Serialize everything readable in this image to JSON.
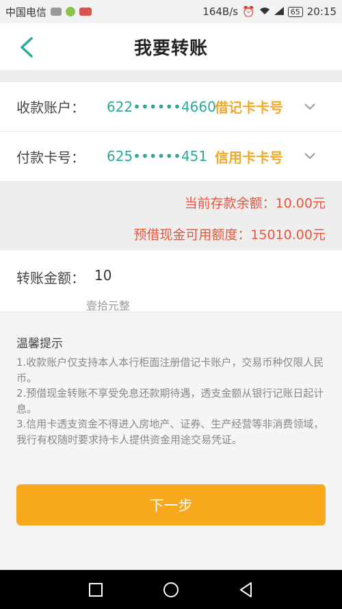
{
  "status_bar": {
    "carrier": "中国电信",
    "speed": "164B/s",
    "battery": "65",
    "time": "20:15"
  },
  "header": {
    "title": "我要转账"
  },
  "payee": {
    "label": "收款账户：",
    "number": "622••••••4660",
    "type": "借记卡卡号"
  },
  "payer": {
    "label": "付款卡号：",
    "number": "625••••••451",
    "type": "信用卡卡号"
  },
  "balance": {
    "deposit": "当前存款余额：10.00元",
    "cash_limit": "预借现金可用额度：15010.00元"
  },
  "amount": {
    "label": "转账金额：",
    "value": "10",
    "chinese": "壹拾元整"
  },
  "tips": {
    "title": "温馨提示",
    "items": [
      "1.收款账户仅支持本人本行柜面注册借记卡账户，交易币种仅限人民币。",
      "2.预借现金转账不享受免息还款期待遇，透支金额从银行记账日起计息。",
      "3.信用卡透支资金不得进入房地产、证券、生产经营等非消费领域，我行有权随时要求持卡人提供资金用途交易凭证。"
    ]
  },
  "buttons": {
    "next": "下一步"
  },
  "colors": {
    "accent": "#f8a81b",
    "teal": "#2aa89a",
    "red": "#e9543c",
    "card_type": "#f2a92a"
  }
}
